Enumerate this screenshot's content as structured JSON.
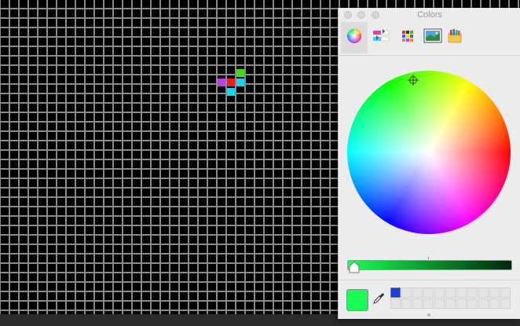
{
  "panel": {
    "title": "Colors",
    "tabs": [
      {
        "name": "color-wheel-tab",
        "icon": "color-wheel-icon",
        "selected": true
      },
      {
        "name": "color-sliders-tab",
        "icon": "color-sliders-icon",
        "selected": false
      },
      {
        "name": "color-palettes-tab",
        "icon": "color-palettes-icon",
        "selected": false
      },
      {
        "name": "image-palettes-tab",
        "icon": "image-palettes-icon",
        "selected": false
      },
      {
        "name": "crayons-tab",
        "icon": "crayons-icon",
        "selected": false
      }
    ],
    "current_color": "#19ff55",
    "brightness_slider_level": 0.02,
    "saved_swatches": [
      "#1a3de0"
    ]
  },
  "canvas": {
    "background": "#000000",
    "gridline_color": "#8a8a8a",
    "colored_cells": [
      {
        "name": "cell-green",
        "color": "#3ddc14"
      },
      {
        "name": "cell-magenta",
        "color": "#c23ce8"
      },
      {
        "name": "cell-red",
        "color": "#f01c1c"
      },
      {
        "name": "cell-cyan-right",
        "color": "#18d4f2"
      },
      {
        "name": "cell-cyan-below",
        "color": "#18d4f2"
      }
    ]
  }
}
